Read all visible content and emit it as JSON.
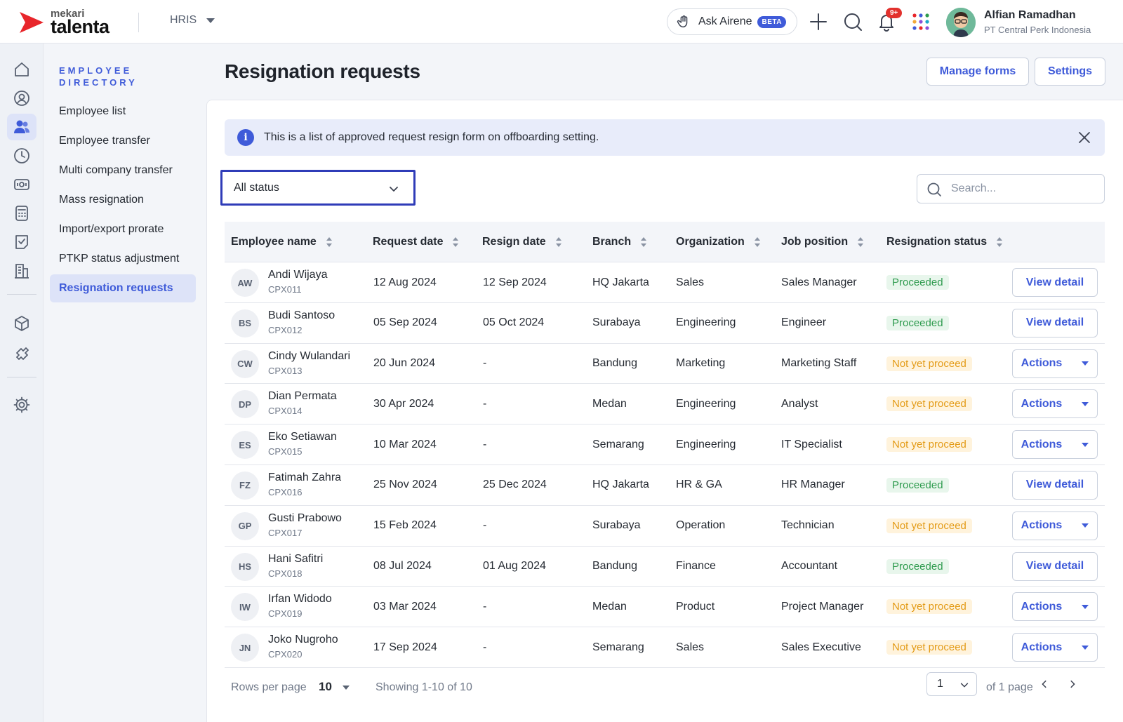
{
  "brand": {
    "small": "mekari",
    "name": "talenta"
  },
  "module": {
    "label": "HRIS"
  },
  "header": {
    "ask_label": "Ask Airene",
    "ask_badge": "BETA",
    "notification_count": "9+",
    "user_name": "Alfian Ramadhan",
    "user_company": "PT Central Perk Indonesia"
  },
  "rail": {
    "icons": [
      "home-icon",
      "profile-icon",
      "employees-icon",
      "time-icon",
      "payroll-icon",
      "calculator-icon",
      "task-icon",
      "company-icon",
      "package-icon",
      "integration-icon",
      "settings-icon"
    ],
    "active": "employees-icon"
  },
  "sidebar": {
    "title": "EMPLOYEE DIRECTORY",
    "items": [
      {
        "label": "Employee list"
      },
      {
        "label": "Employee transfer"
      },
      {
        "label": "Multi company transfer"
      },
      {
        "label": "Mass resignation"
      },
      {
        "label": "Import/export prorate"
      },
      {
        "label": "PTKP status adjustment"
      },
      {
        "label": "Resignation requests",
        "active": true
      }
    ]
  },
  "page": {
    "title": "Resignation requests",
    "manage_forms": "Manage forms",
    "settings": "Settings"
  },
  "banner": {
    "text": "This is a list of approved request resign form on offboarding setting."
  },
  "filters": {
    "status_value": "All status",
    "search_placeholder": "Search..."
  },
  "table": {
    "columns": [
      "Employee name",
      "Request date",
      "Resign date",
      "Branch",
      "Organization",
      "Job position",
      "Resignation status"
    ],
    "rows": [
      {
        "initials": "AW",
        "name": "Andi Wijaya",
        "id": "CPX011",
        "request_date": "12 Aug 2024",
        "resign_date": "12 Sep 2024",
        "branch": "HQ Jakarta",
        "organization": "Sales",
        "job_position": "Sales Manager",
        "status": "Proceeded",
        "action": "View detail"
      },
      {
        "initials": "BS",
        "name": "Budi Santoso",
        "id": "CPX012",
        "request_date": "05 Sep 2024",
        "resign_date": "05 Oct 2024",
        "branch": "Surabaya",
        "organization": "Engineering",
        "job_position": "Engineer",
        "status": "Proceeded",
        "action": "View detail"
      },
      {
        "initials": "CW",
        "name": "Cindy Wulandari",
        "id": "CPX013",
        "request_date": "20 Jun 2024",
        "resign_date": "-",
        "branch": "Bandung",
        "organization": "Marketing",
        "job_position": "Marketing Staff",
        "status": "Not yet proceed",
        "action": "Actions"
      },
      {
        "initials": "DP",
        "name": "Dian Permata",
        "id": "CPX014",
        "request_date": "30 Apr 2024",
        "resign_date": "-",
        "branch": "Medan",
        "organization": "Engineering",
        "job_position": "Analyst",
        "status": "Not yet proceed",
        "action": "Actions"
      },
      {
        "initials": "ES",
        "name": "Eko Setiawan",
        "id": "CPX015",
        "request_date": "10 Mar 2024",
        "resign_date": "-",
        "branch": "Semarang",
        "organization": "Engineering",
        "job_position": "IT Specialist",
        "status": "Not yet proceed",
        "action": "Actions"
      },
      {
        "initials": "FZ",
        "name": "Fatimah Zahra",
        "id": "CPX016",
        "request_date": "25 Nov 2024",
        "resign_date": "25 Dec 2024",
        "branch": "HQ Jakarta",
        "organization": "HR & GA",
        "job_position": "HR Manager",
        "status": "Proceeded",
        "action": "View detail"
      },
      {
        "initials": "GP",
        "name": "Gusti Prabowo",
        "id": "CPX017",
        "request_date": "15 Feb 2024",
        "resign_date": "-",
        "branch": "Surabaya",
        "organization": "Operation",
        "job_position": "Technician",
        "status": "Not yet proceed",
        "action": "Actions"
      },
      {
        "initials": "HS",
        "name": "Hani Safitri",
        "id": "CPX018",
        "request_date": "08 Jul 2024",
        "resign_date": "01 Aug 2024",
        "branch": "Bandung",
        "organization": "Finance",
        "job_position": "Accountant",
        "status": "Proceeded",
        "action": "View detail"
      },
      {
        "initials": "IW",
        "name": "Irfan Widodo",
        "id": "CPX019",
        "request_date": "03 Mar 2024",
        "resign_date": "-",
        "branch": "Medan",
        "organization": "Product",
        "job_position": "Project Manager",
        "status": "Not yet proceed",
        "action": "Actions"
      },
      {
        "initials": "JN",
        "name": "Joko Nugroho",
        "id": "CPX020",
        "request_date": "17 Sep 2024",
        "resign_date": "-",
        "branch": "Semarang",
        "organization": "Sales",
        "job_position": "Sales Executive",
        "status": "Not yet proceed",
        "action": "Actions"
      }
    ]
  },
  "pagination": {
    "rows_per_page_label": "Rows per page",
    "rows_per_page_value": "10",
    "showing": "Showing 1-10 of 10",
    "page": "1",
    "of_pages": "of 1 page"
  },
  "colors": {
    "accent": "#3F5BD9",
    "proceeded": "#2E9B4E",
    "pending": "#E39B17",
    "brand_red": "#E8262B"
  }
}
